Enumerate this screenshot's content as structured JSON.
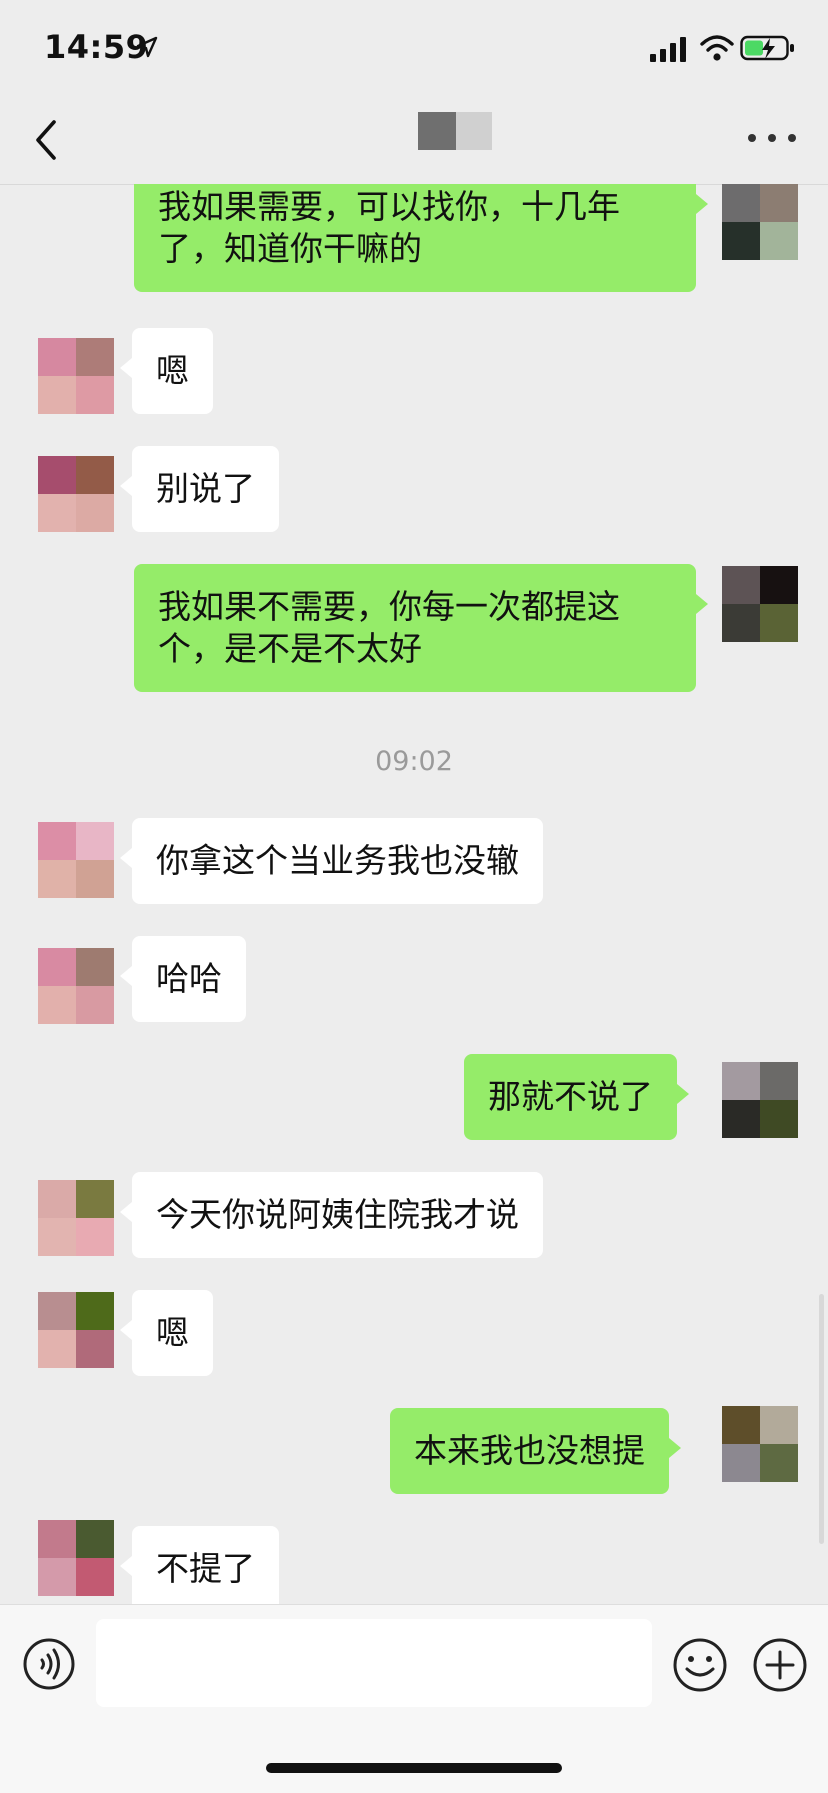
{
  "status_bar": {
    "time": "14:59"
  },
  "nav": {
    "back_icon": "chevron-left-icon",
    "more_icon": "more-dots-icon"
  },
  "messages": [
    {
      "side": "out",
      "text": "我如果需要，可以找你，十几年了，知道你干嘛的"
    },
    {
      "side": "in",
      "text": "嗯"
    },
    {
      "side": "in",
      "text": "别说了"
    },
    {
      "side": "out",
      "text": "我如果不需要，你每一次都提这个，是不是不太好"
    },
    {
      "type": "timestamp",
      "text": "09:02"
    },
    {
      "side": "in",
      "text": "你拿这个当业务我也没辙"
    },
    {
      "side": "in",
      "text": "哈哈"
    },
    {
      "side": "out",
      "text": "那就不说了"
    },
    {
      "side": "in",
      "text": "今天你说阿姨住院我才说"
    },
    {
      "side": "in",
      "text": "嗯"
    },
    {
      "side": "out",
      "text": "本来我也没想提"
    },
    {
      "side": "in",
      "text": "不提了"
    }
  ],
  "input_bar": {
    "placeholder": "",
    "value": ""
  },
  "colors": {
    "background": "#ededed",
    "incoming_bubble": "#ffffff",
    "outgoing_bubble": "#95ec69",
    "timestamp_text": "#9a9a9a"
  }
}
